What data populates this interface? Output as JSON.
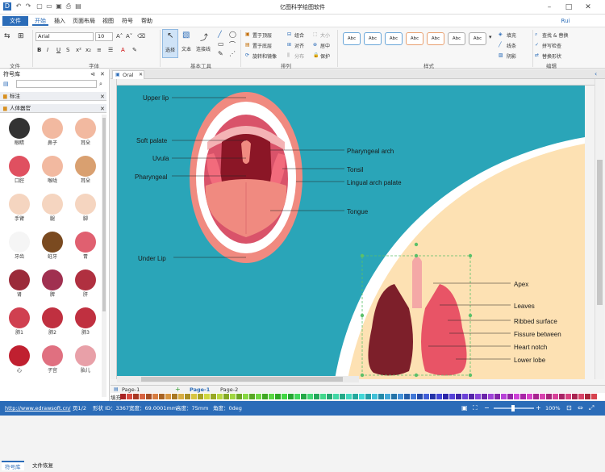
{
  "window": {
    "title": "亿图科学绘图软件",
    "user": "Rui",
    "min_icon": "minimize-icon",
    "max_icon": "maximize-icon",
    "close_icon": "close-icon"
  },
  "menu": {
    "file": "文件",
    "tabs": [
      "开始",
      "插入",
      "页面布局",
      "视图",
      "符号",
      "帮助"
    ]
  },
  "ribbon": {
    "groups": [
      "文件",
      "字体",
      "基本工具",
      "排列",
      "样式",
      "编辑"
    ],
    "font_name": "Arial",
    "font_size": "10",
    "tools": {
      "select": "选择",
      "text": "文本",
      "connector": "连接线"
    },
    "arrange": [
      "置于顶层",
      "置于底层",
      "旋转和镜像",
      "组合",
      "对齐",
      "分布",
      "大小",
      "居中",
      "保护"
    ],
    "style_label": "Abc",
    "fill": "填充",
    "line": "线条",
    "shadow": "阴影",
    "edit": [
      "查找 & 替换",
      "拼写检查",
      "替换形状"
    ]
  },
  "library": {
    "title": "符号库",
    "category1": "标注",
    "category2": "人体器官",
    "items": [
      "眼睛",
      "鼻子",
      "耳朵",
      "口腔",
      "喉咙",
      "耳朵",
      "手臂",
      "腿",
      "脚",
      "牙齿",
      "蛀牙",
      "胃",
      "肾",
      "脾",
      "肝",
      "肺1",
      "肺2",
      "肺3",
      "心",
      "子宫",
      "胎儿"
    ],
    "tab1": "符号库",
    "tab2": "文件恢复"
  },
  "document": {
    "tab": "Oral"
  },
  "diagram": {
    "mouth_labels": [
      "Upper lip",
      "Soft palate",
      "Uvula",
      "Pharyngeal",
      "Under Lip",
      "Pharyngeal arch",
      "Tonsil",
      "Lingual arch palate",
      "Tongue"
    ],
    "lung_labels": [
      "Apex",
      "Leaves",
      "Ribbed surface",
      "Fissure between",
      "Heart notch",
      "Lower lobe"
    ]
  },
  "pages": {
    "selector": "Page-1",
    "page1": "Page-1",
    "page2": "Page-2",
    "add": "+"
  },
  "colorbar_label": "填充",
  "status": {
    "url": "http://www.edrawsoft.cn/",
    "page": "页1/2",
    "shape_id": "形状 ID：3367",
    "width": "宽度：69.0001mm",
    "height": "高度：75mm",
    "angle": "角度：0deg",
    "zoom": "100%"
  }
}
